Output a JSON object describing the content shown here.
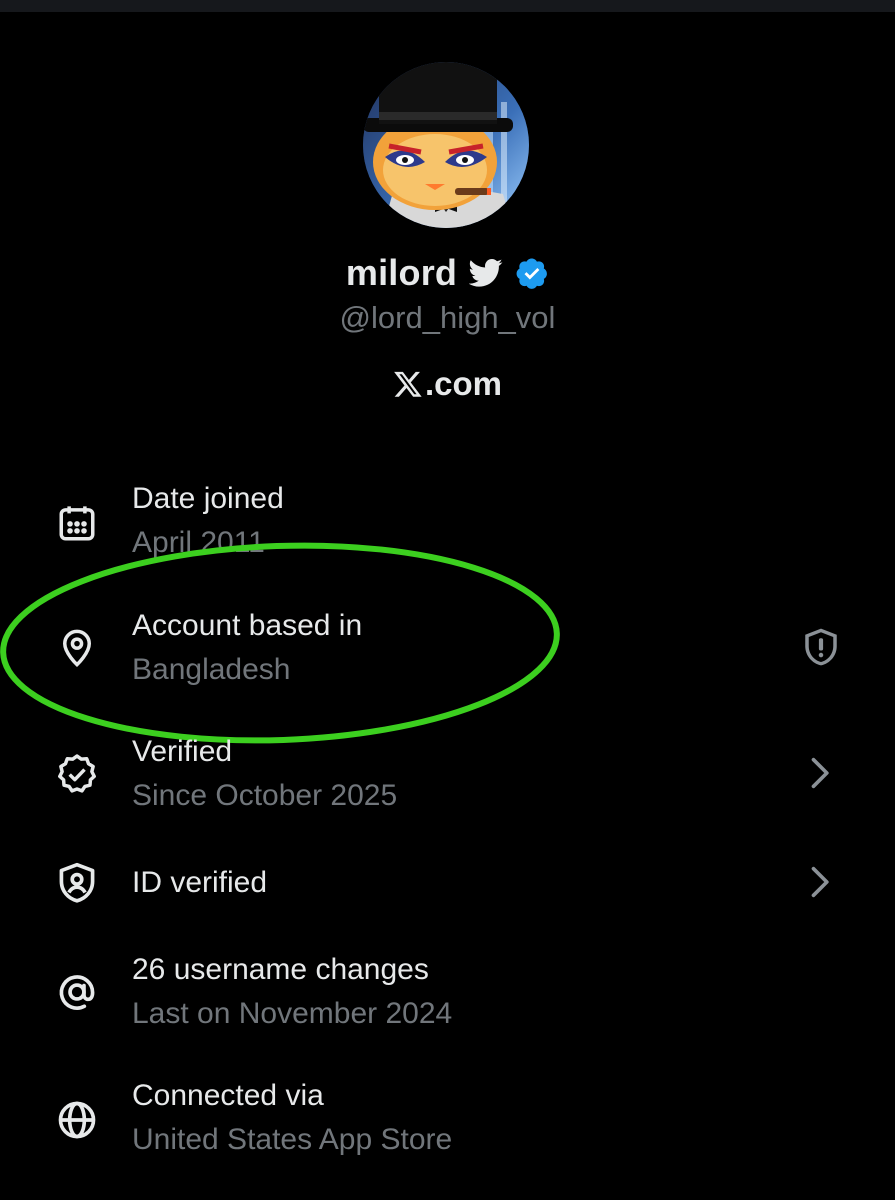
{
  "profile": {
    "display_name": "milord",
    "handle": "@lord_high_vol",
    "site": ".com",
    "site_logo": "x-logo-icon",
    "verified_badge_color": "#1d9bf0"
  },
  "rows": [
    {
      "icon": "calendar-icon",
      "title": "Date joined",
      "subtitle": "April 2011"
    },
    {
      "icon": "location-pin-icon",
      "title": "Account based in",
      "subtitle": "Bangladesh",
      "right_icon": "shield-alert-icon"
    },
    {
      "icon": "verified-badge-icon",
      "title": "Verified",
      "subtitle": "Since October 2025",
      "right_icon": "chevron-right-icon"
    },
    {
      "icon": "id-shield-icon",
      "title": "ID verified",
      "right_icon": "chevron-right-icon"
    },
    {
      "icon": "at-sign-icon",
      "title": "26 username changes",
      "subtitle": "Last on November 2024"
    },
    {
      "icon": "globe-icon",
      "title": "Connected via",
      "subtitle": "United States App Store"
    }
  ],
  "colors": {
    "background": "#000000",
    "primary_text": "#e7e9ea",
    "secondary_text": "#71767b",
    "highlight_ring": "#3ccf1f"
  }
}
